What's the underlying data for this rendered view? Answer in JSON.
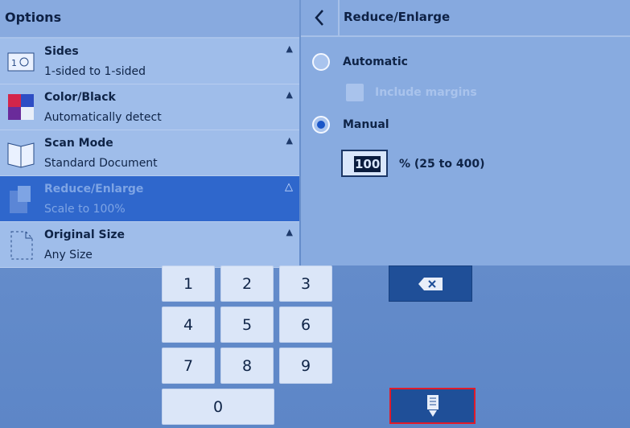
{
  "left": {
    "header": "Options",
    "items": [
      {
        "title": "Sides",
        "value": "1-sided to 1-sided",
        "icon": "sides-icon",
        "selected": false
      },
      {
        "title": "Color/Black",
        "value": "Automatically detect",
        "icon": "color-icon",
        "selected": false
      },
      {
        "title": "Scan Mode",
        "value": "Standard Document",
        "icon": "scan-mode-icon",
        "selected": false
      },
      {
        "title": "Reduce/Enlarge",
        "value": "Scale to 100%",
        "icon": "reduce-enlarge-icon",
        "selected": true
      },
      {
        "title": "Original Size",
        "value": "Any Size",
        "icon": "original-size-icon",
        "selected": false
      }
    ]
  },
  "right": {
    "title": "Reduce/Enlarge",
    "automatic_label": "Automatic",
    "include_margins_label": "Include margins",
    "manual_label": "Manual",
    "manual_selected": true,
    "percent_value": "100",
    "percent_range": "%  (25 to 400)"
  },
  "keypad": {
    "keys": [
      "1",
      "2",
      "3",
      "4",
      "5",
      "6",
      "7",
      "8",
      "9",
      "0"
    ],
    "backspace_icon": "backspace-icon",
    "done_icon": "done-scan-icon"
  },
  "colors": {
    "selected_item": "#2f67cc",
    "highlight_border": "#e01b2a"
  }
}
